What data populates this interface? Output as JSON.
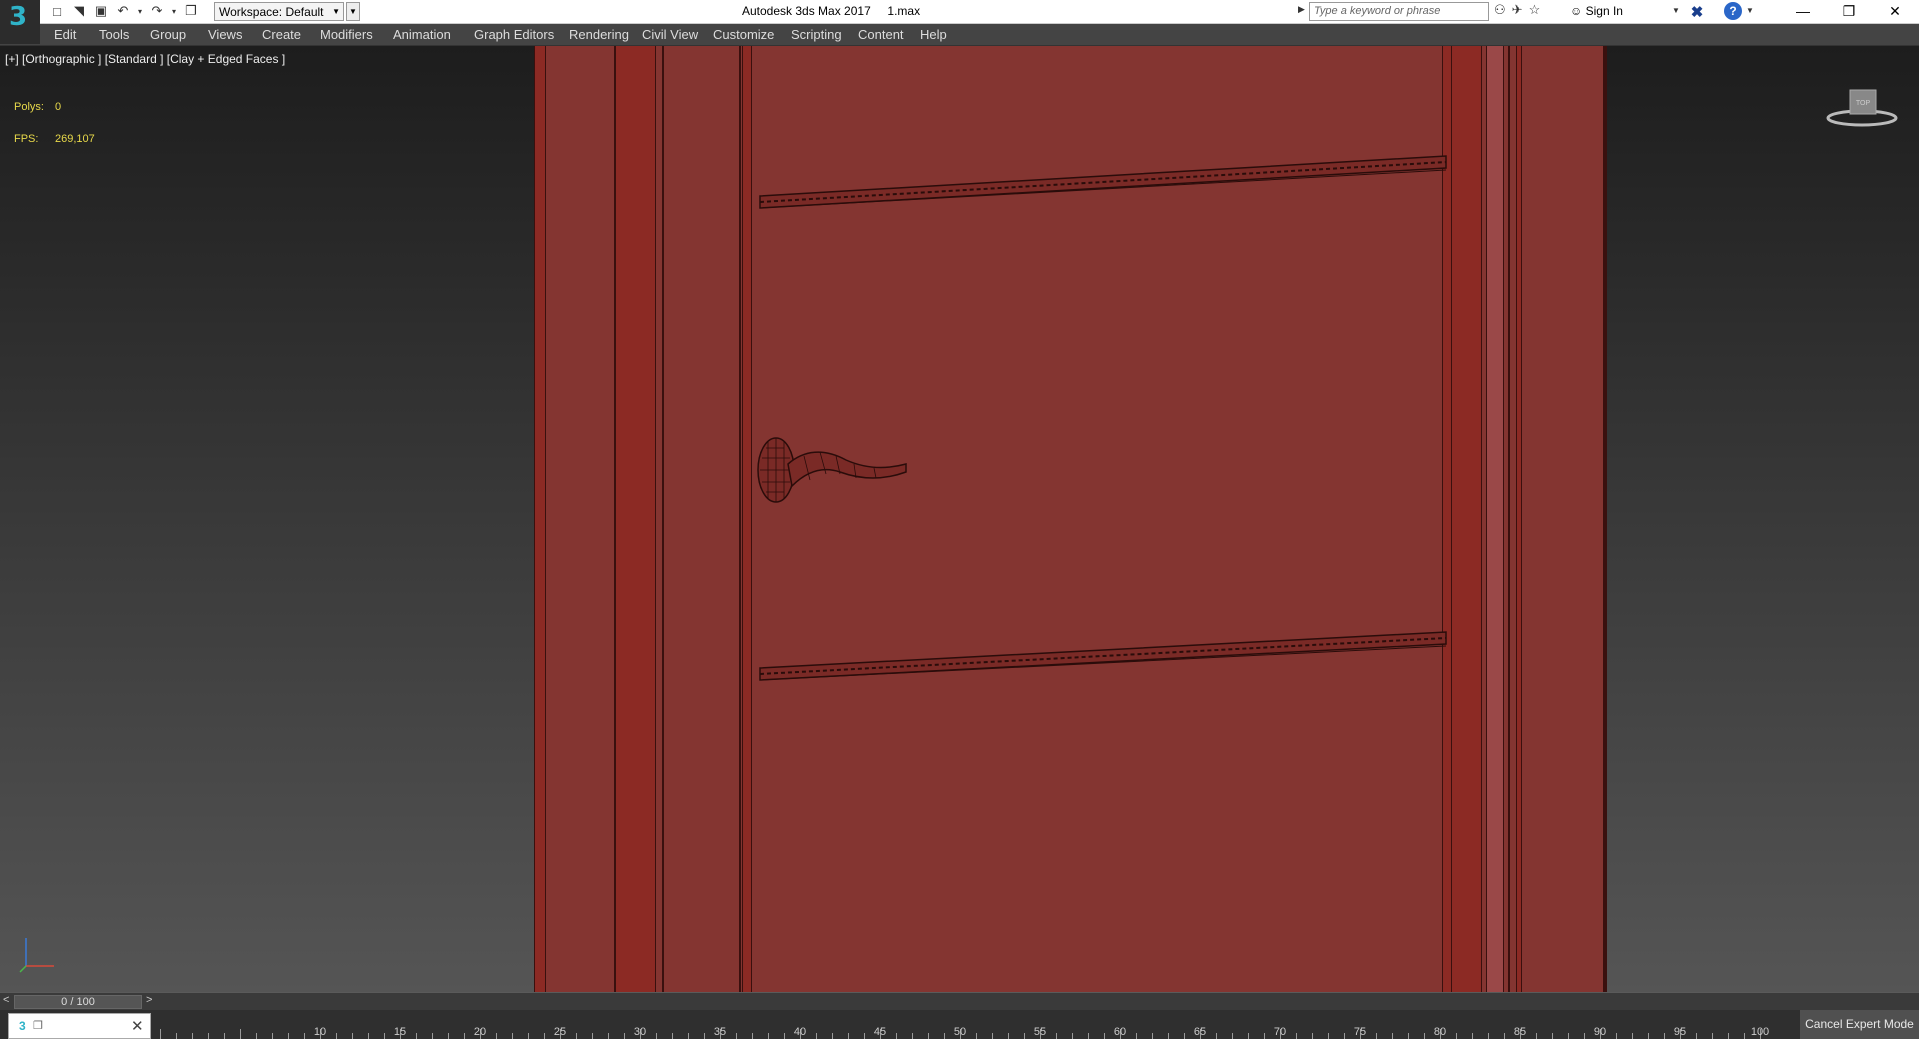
{
  "app": {
    "title": "Autodesk 3ds Max 2017     1.max",
    "logo": "3",
    "workspace": "Workspace: Default"
  },
  "search": {
    "placeholder": "Type a keyword or phrase"
  },
  "account": {
    "signin": "Sign In"
  },
  "help": {
    "label": "?"
  },
  "menu": {
    "items": [
      "Edit",
      "Tools",
      "Group",
      "Views",
      "Create",
      "Modifiers",
      "Animation",
      "Graph Editors",
      "Rendering",
      "Civil View",
      "Customize",
      "Scripting",
      "Content",
      "Help"
    ]
  },
  "viewport": {
    "label": "[+] [Orthographic ] [Standard ] [Clay + Edged Faces ]",
    "polys_label": "Polys:",
    "polys_value": "0",
    "fps_label": "FPS:",
    "fps_value": "269,107",
    "viewcube_label": "TOP"
  },
  "timeline": {
    "frame": "0 / 100",
    "prev": "<",
    "next": ">"
  },
  "ruler": {
    "labels": [
      "10",
      "15",
      "20",
      "25",
      "30",
      "35",
      "40",
      "45",
      "50",
      "55",
      "60",
      "65",
      "70",
      "75",
      "80",
      "85",
      "90",
      "95",
      "100"
    ]
  },
  "status": {
    "expert_mode": "Cancel Expert Mode"
  },
  "colors": {
    "door": "#843531",
    "door_dark": "#8c2a24",
    "accent": "#2fb3c8",
    "stats": "#e8d94a"
  }
}
